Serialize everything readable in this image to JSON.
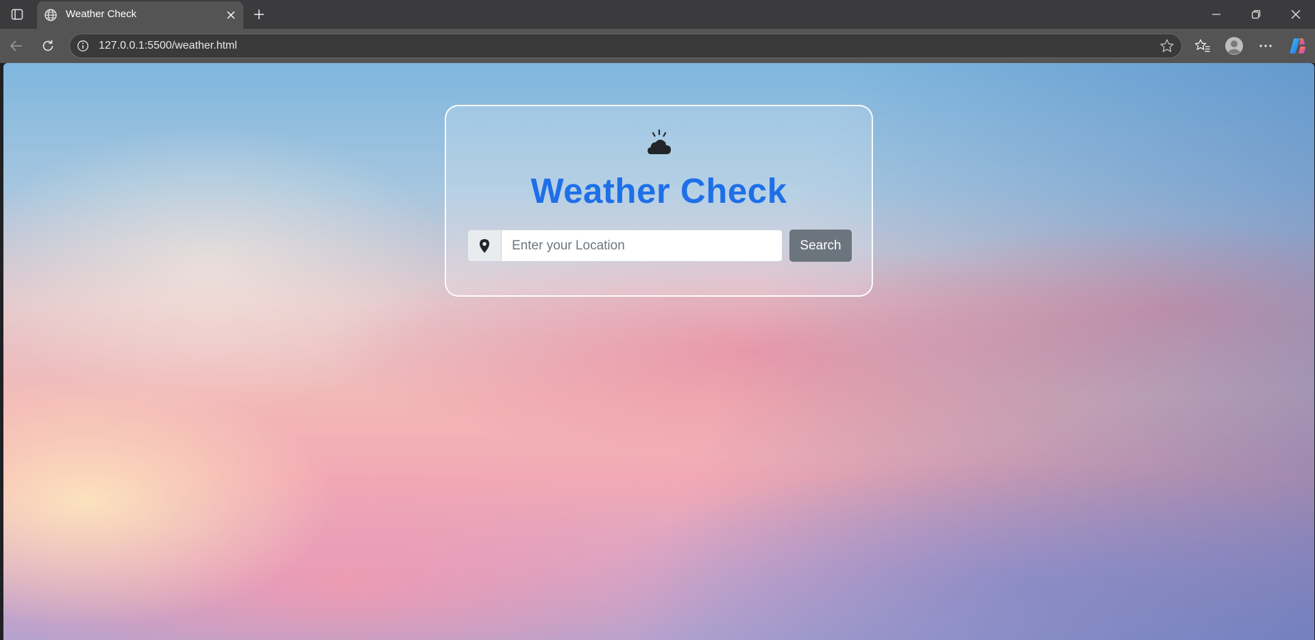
{
  "browser": {
    "tab": {
      "title": "Weather Check",
      "favicon": "globe-icon"
    },
    "address_bar": {
      "url": "127.0.0.1:5500/weather.html"
    },
    "icons": {
      "tab_actions": "tab-actions-icon",
      "close_tab": "close-icon",
      "new_tab": "plus-icon",
      "minimize": "minimize-icon",
      "restore": "restore-icon",
      "close_window": "close-icon",
      "back": "back-arrow-icon",
      "reload": "reload-icon",
      "site_info": "info-icon",
      "favorite": "star-icon",
      "favorites": "favorites-icon",
      "profile": "profile-icon",
      "more": "more-icon",
      "copilot": "copilot-icon"
    }
  },
  "page": {
    "title": "Weather Check",
    "logo_icon": "cloud-sun-icon",
    "search": {
      "placeholder": "Enter your Location",
      "value": "",
      "location_icon": "map-pin-icon",
      "button_label": "Search"
    }
  },
  "colors": {
    "title": "#1e6fe8",
    "search_button": "#6c757d",
    "tab_strip": "#3b3b3d",
    "toolbar": "#545454"
  }
}
